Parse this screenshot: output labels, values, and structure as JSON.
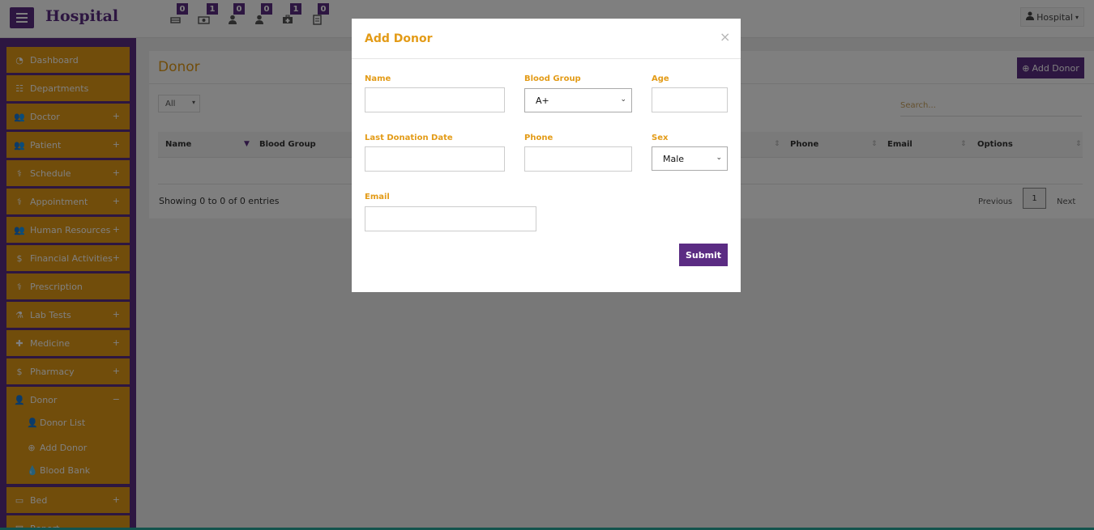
{
  "header": {
    "brand": "Hospital",
    "user_label": "Hospital",
    "notifications": [
      {
        "icon": "bed-icon",
        "count": "0"
      },
      {
        "icon": "money-icon",
        "count": "1"
      },
      {
        "icon": "user-icon",
        "count": "0"
      },
      {
        "icon": "user-icon",
        "count": "0"
      },
      {
        "icon": "medkit-icon",
        "count": "1"
      },
      {
        "icon": "report-icon",
        "count": "0"
      }
    ]
  },
  "sidebar": {
    "items": [
      {
        "label": "Dashboard",
        "icon": "dashboard-icon"
      },
      {
        "label": "Departments",
        "icon": "sitemap-icon"
      },
      {
        "label": "Doctor",
        "icon": "users-icon"
      },
      {
        "label": "Patient",
        "icon": "users-icon"
      },
      {
        "label": "Schedule",
        "icon": "stethoscope-icon"
      },
      {
        "label": "Appointment",
        "icon": "stethoscope-icon"
      },
      {
        "label": "Human Resources",
        "icon": "users-icon"
      },
      {
        "label": "Financial Activities",
        "icon": "dollar-icon"
      },
      {
        "label": "Prescription",
        "icon": "stethoscope-icon"
      },
      {
        "label": "Lab Tests",
        "icon": "flask-icon"
      },
      {
        "label": "Medicine",
        "icon": "medkit-icon"
      },
      {
        "label": "Pharmacy",
        "icon": "dollar-icon"
      },
      {
        "label": "Donor",
        "icon": "user-icon"
      },
      {
        "label": "Bed",
        "icon": "bed-icon"
      },
      {
        "label": "Report",
        "icon": "report-icon"
      }
    ],
    "donor_submenu": [
      {
        "label": "Donor List",
        "icon": "user-icon"
      },
      {
        "label": "Add Donor",
        "icon": "plus-circle-icon"
      },
      {
        "label": "Blood Bank",
        "icon": "drop-icon"
      }
    ]
  },
  "page": {
    "title": "Donor",
    "add_button": "Add Donor",
    "filter_value": "All",
    "search_placeholder": "Search...",
    "columns": [
      "Name",
      "Blood Group",
      "Phone",
      "Email",
      "Options"
    ],
    "showing_text": "Showing 0 to 0 of 0 entries",
    "pagination": {
      "previous": "Previous",
      "page": "1",
      "next": "Next"
    }
  },
  "modal": {
    "title": "Add Donor",
    "close": "×",
    "fields": {
      "name_label": "Name",
      "blood_group_label": "Blood Group",
      "blood_group_value": "A+",
      "age_label": "Age",
      "last_donation_label": "Last Donation Date",
      "phone_label": "Phone",
      "sex_label": "Sex",
      "sex_value": "Male",
      "email_label": "Email"
    },
    "submit": "Submit"
  },
  "colors": {
    "primary": "#5b2c83",
    "accent": "#e39b17"
  }
}
